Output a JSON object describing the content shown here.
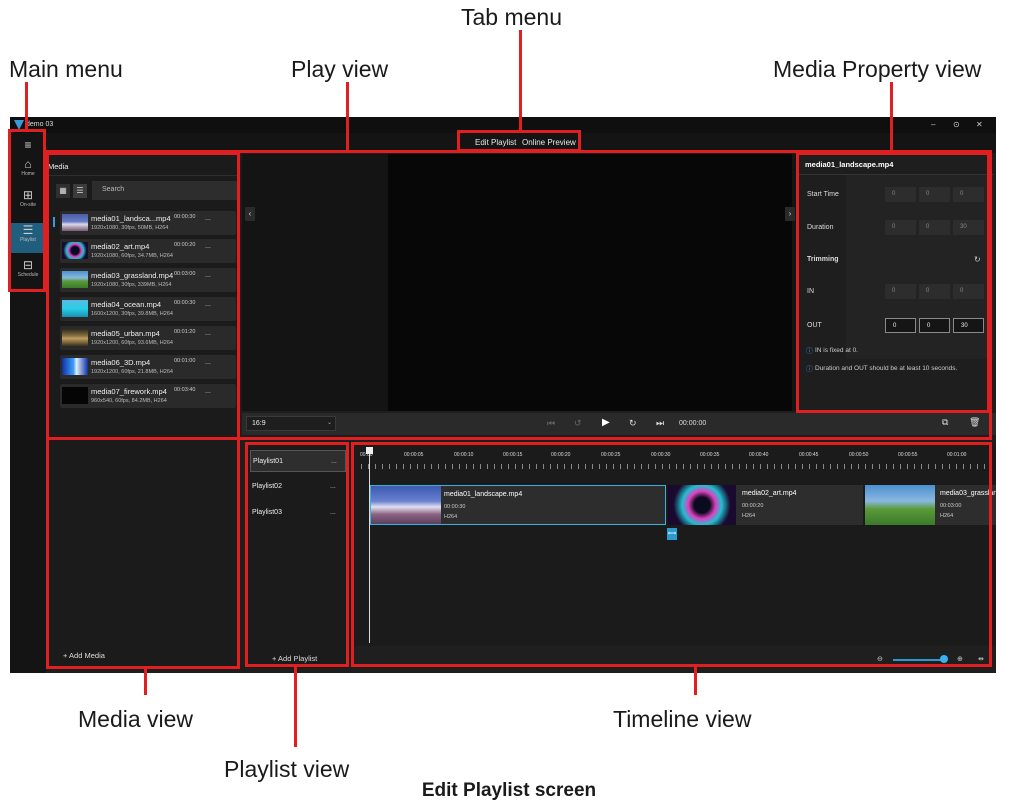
{
  "callouts": {
    "tab_menu": "Tab menu",
    "main_menu": "Main menu",
    "play_view": "Play view",
    "media_property_view": "Media Property view",
    "media_view": "Media view",
    "timeline_view": "Timeline view",
    "playlist_view": "Playlist view"
  },
  "caption": "Edit Playlist screen",
  "window": {
    "title": "demo 03",
    "controls": [
      "–",
      "⊙",
      "✕"
    ]
  },
  "tabs": [
    "Edit Playlist",
    "Online Preview"
  ],
  "sidebar": {
    "items": [
      {
        "label": "Home",
        "icon": "home-icon"
      },
      {
        "label": "On-site",
        "icon": "onsite-icon"
      },
      {
        "label": "Playlist",
        "icon": "playlist-icon"
      },
      {
        "label": "Schedule",
        "icon": "schedule-icon"
      }
    ]
  },
  "media": {
    "title": "Media",
    "search_placeholder": "Search",
    "add_label": "+ Add Media",
    "items": [
      {
        "name": "media01_landsca...mp4",
        "duration": "00:00:30",
        "meta": "1920x1080, 30fps, 50MB, H264"
      },
      {
        "name": "media02_art.mp4",
        "duration": "00:00:20",
        "meta": "1920x1080, 60fps, 34.7MB, H264"
      },
      {
        "name": "media03_grassland.mp4",
        "duration": "00:03:00",
        "meta": "1920x1080, 30fps, 339MB, H264"
      },
      {
        "name": "media04_ocean.mp4",
        "duration": "00:00:30",
        "meta": "1600x1200, 30fps, 39.8MB, H264"
      },
      {
        "name": "media05_urban.mp4",
        "duration": "00:01:20",
        "meta": "1920x1200, 60fps, 93.6MB, H264"
      },
      {
        "name": "media06_3D.mp4",
        "duration": "00:01:00",
        "meta": "1920x1200, 60fps, 21.8MB, H264"
      },
      {
        "name": "media07_firework.mp4",
        "duration": "00:03:40",
        "meta": "960x540, 60fps, 84.2MB, H264"
      }
    ],
    "more": "..."
  },
  "property": {
    "file": "media01_landscape.mp4",
    "start_time": {
      "label": "Start Time",
      "values": [
        "0",
        "0",
        "0"
      ]
    },
    "duration": {
      "label": "Duration",
      "values": [
        "0",
        "0",
        "30"
      ]
    },
    "trimming": "Trimming",
    "in": {
      "label": "IN",
      "values": [
        "0",
        "0",
        "0"
      ]
    },
    "out": {
      "label": "OUT",
      "values": [
        "0",
        "0",
        "30"
      ]
    },
    "notes": [
      "IN is fixed at 0.",
      "Duration and OUT should be at least 10 seconds."
    ]
  },
  "controls": {
    "ratio": "16:9",
    "time": "00:00:00"
  },
  "playlists": {
    "items": [
      "Playlist01",
      "Playlist02",
      "Playlist03"
    ],
    "more": "...",
    "add_label": "+ Add Playlist"
  },
  "timeline": {
    "ticks": [
      "00:00",
      "00:00:05",
      "00:00:10",
      "00:00:15",
      "00:00:20",
      "00:00:25",
      "00:00:30",
      "00:00:35",
      "00:00:40",
      "00:00:45",
      "00:00:50",
      "00:00:55",
      "00:01:00"
    ],
    "clips": [
      {
        "name": "media01_landscape.mp4",
        "duration": "00:00:30",
        "codec": "H264"
      },
      {
        "name": "media02_art.mp4",
        "duration": "00:00:20",
        "codec": "H264"
      },
      {
        "name": "media03_grasslan",
        "duration": "00:03:00",
        "codec": "H264"
      }
    ]
  }
}
